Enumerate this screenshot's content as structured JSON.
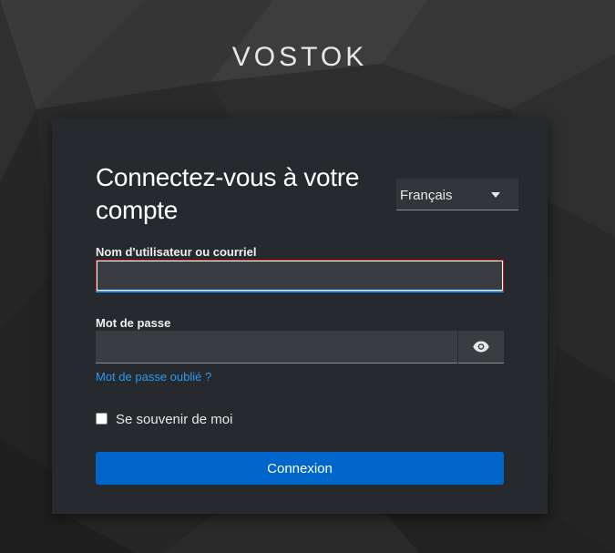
{
  "brand": {
    "name": "VOSTOK"
  },
  "login": {
    "title": "Connectez-vous à votre compte",
    "language": {
      "selected": "Français",
      "icon": "caret-down-icon"
    },
    "username": {
      "label": "Nom d'utilisateur ou courriel",
      "value": ""
    },
    "password": {
      "label": "Mot de passe",
      "value": "",
      "toggle_icon": "eye-icon"
    },
    "forgot_password": "Mot de passe oublié ?",
    "remember_me": {
      "label": "Se souvenir de moi",
      "checked": false
    },
    "submit_label": "Connexion"
  },
  "colors": {
    "card_background": "#26292d",
    "accent_blue": "#0066cc",
    "link_blue": "#2b9af3",
    "error_red": "#c9190b"
  }
}
